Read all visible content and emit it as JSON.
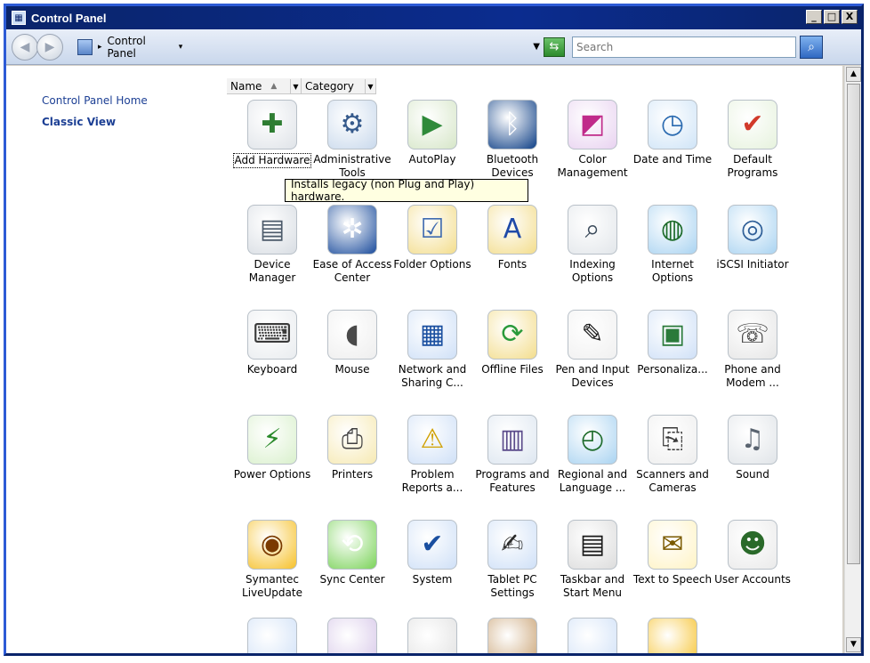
{
  "window": {
    "title": "Control Panel",
    "controls": [
      "_",
      "□",
      "X"
    ]
  },
  "address": {
    "path": "Control Panel",
    "search_placeholder": "Search"
  },
  "sidebar": {
    "links": [
      "Control Panel Home",
      "Classic View"
    ]
  },
  "columns": [
    {
      "label": "Name"
    },
    {
      "label": "Category"
    }
  ],
  "tooltip": "Installs legacy (non Plug and Play) hardware.",
  "items": [
    {
      "label": "Add Hardware",
      "icon": "add-hardware-icon"
    },
    {
      "label": "Administrative Tools",
      "icon": "admin-tools-icon"
    },
    {
      "label": "AutoPlay",
      "icon": "autoplay-icon"
    },
    {
      "label": "Bluetooth Devices",
      "icon": "bluetooth-icon"
    },
    {
      "label": "Color Management",
      "icon": "color-management-icon"
    },
    {
      "label": "Date and Time",
      "icon": "date-time-icon"
    },
    {
      "label": "Default Programs",
      "icon": "default-programs-icon"
    },
    {
      "label": "Device Manager",
      "icon": "device-manager-icon"
    },
    {
      "label": "Ease of Access Center",
      "icon": "ease-of-access-icon"
    },
    {
      "label": "Folder Options",
      "icon": "folder-options-icon"
    },
    {
      "label": "Fonts",
      "icon": "fonts-icon"
    },
    {
      "label": "Indexing Options",
      "icon": "indexing-icon"
    },
    {
      "label": "Internet Options",
      "icon": "internet-options-icon"
    },
    {
      "label": "iSCSI Initiator",
      "icon": "iscsi-icon"
    },
    {
      "label": "Keyboard",
      "icon": "keyboard-icon"
    },
    {
      "label": "Mouse",
      "icon": "mouse-icon"
    },
    {
      "label": "Network and Sharing C...",
      "icon": "network-icon"
    },
    {
      "label": "Offline Files",
      "icon": "offline-files-icon"
    },
    {
      "label": "Pen and Input Devices",
      "icon": "pen-input-icon"
    },
    {
      "label": "Personaliza...",
      "icon": "personalization-icon"
    },
    {
      "label": "Phone and Modem ...",
      "icon": "phone-modem-icon"
    },
    {
      "label": "Power Options",
      "icon": "power-options-icon"
    },
    {
      "label": "Printers",
      "icon": "printers-icon"
    },
    {
      "label": "Problem Reports a...",
      "icon": "problem-reports-icon"
    },
    {
      "label": "Programs and Features",
      "icon": "programs-features-icon"
    },
    {
      "label": "Regional and Language ...",
      "icon": "regional-icon"
    },
    {
      "label": "Scanners and Cameras",
      "icon": "scanner-icon"
    },
    {
      "label": "Sound",
      "icon": "sound-icon"
    },
    {
      "label": "Symantec LiveUpdate",
      "icon": "liveupdate-icon"
    },
    {
      "label": "Sync Center",
      "icon": "sync-icon"
    },
    {
      "label": "System",
      "icon": "system-icon"
    },
    {
      "label": "Tablet PC Settings",
      "icon": "tablet-icon"
    },
    {
      "label": "Taskbar and Start Menu",
      "icon": "taskbar-icon"
    },
    {
      "label": "Text to Speech",
      "icon": "text-speech-icon"
    },
    {
      "label": "User Accounts",
      "icon": "user-accounts-icon"
    }
  ]
}
